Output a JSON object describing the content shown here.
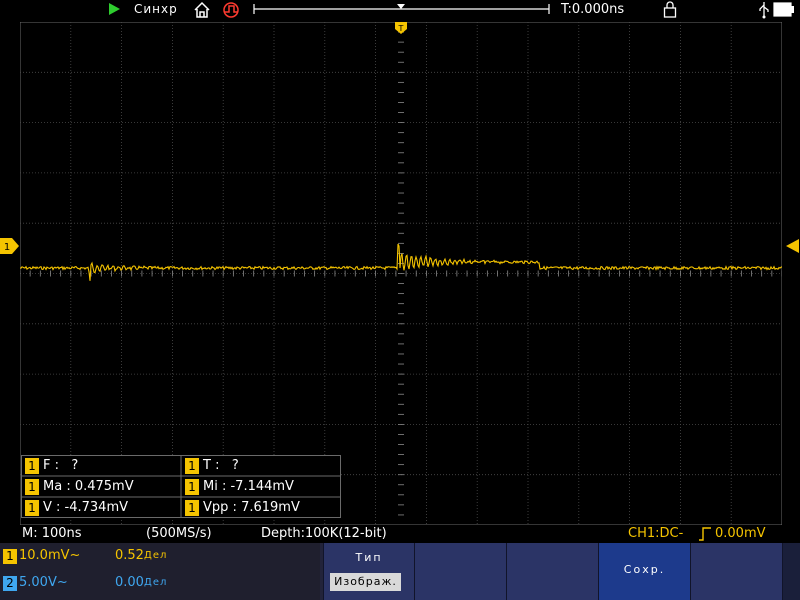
{
  "status": {
    "run_state": "Синхр",
    "trigger_delay": "T:0.000ns"
  },
  "measurements": [
    {
      "channel": "1",
      "label": "F :",
      "value": "?"
    },
    {
      "channel": "1",
      "label": "T :",
      "value": "?"
    },
    {
      "channel": "1",
      "label": "Ma :",
      "value": "0.475mV"
    },
    {
      "channel": "1",
      "label": "Mi :",
      "value": "-7.144mV"
    },
    {
      "channel": "1",
      "label": "V :",
      "value": "-4.734mV"
    },
    {
      "channel": "1",
      "label": "Vpp :",
      "value": "7.619mV"
    }
  ],
  "info": {
    "timebase": "M: 100ns",
    "sample_rate": "(500MS/s)",
    "depth": "Depth:100K(12-bit)",
    "trigger": "CH1:DC-",
    "trigger_level": "0.00mV"
  },
  "channels": [
    {
      "id": "1",
      "scale": "10.0mV~",
      "offset": "0.52",
      "offset_unit": "Дел",
      "color": "#f5c400"
    },
    {
      "id": "2",
      "scale": "5.00V~",
      "offset": "0.00",
      "offset_unit": "Дел",
      "color": "#3fa7f0"
    }
  ],
  "softkeys": {
    "type_title": "Тип",
    "type_value": "Изображ.",
    "save_title": "Сохр."
  },
  "colors": {
    "ch1": "#f5c400",
    "ch2": "#3fa7f0",
    "grid": "#5a5a5a",
    "run": "#2ecc2e"
  }
}
